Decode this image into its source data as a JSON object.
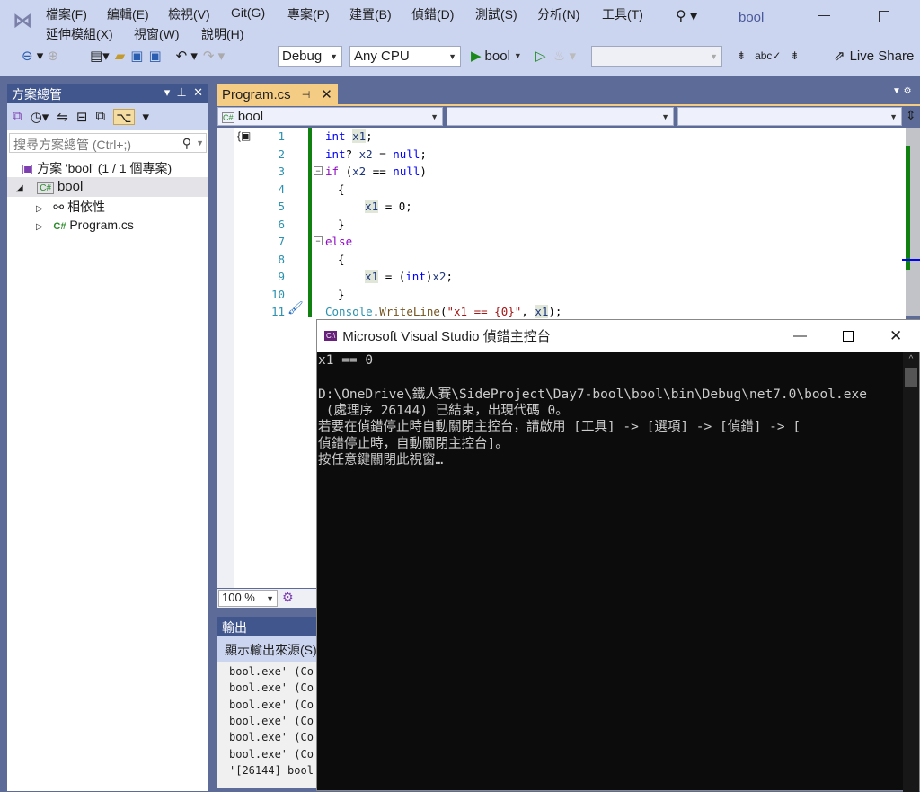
{
  "menu": [
    "檔案(F)",
    "編輯(E)",
    "檢視(V)",
    "Git(G)",
    "專案(P)",
    "建置(B)",
    "偵錯(D)",
    "測試(S)",
    "分析(N)",
    "工具(T)"
  ],
  "menu2": [
    "延伸模組(X)",
    "視窗(W)",
    "說明(H)"
  ],
  "window_title": "bool",
  "toolbar": {
    "config": "Debug",
    "platform": "Any CPU",
    "start": "bool",
    "live_share": "Live Share"
  },
  "solution_explorer": {
    "title": "方案總管",
    "search_placeholder": "搜尋方案總管 (Ctrl+;)",
    "solution": "方案 'bool' (1 / 1 個專案)",
    "project": "bool",
    "dependencies": "相依性",
    "file": "Program.cs"
  },
  "editor": {
    "tab": "Program.cs",
    "nav_scope": "bool",
    "zoom": "100 %",
    "lines": [
      [
        {
          "t": "int ",
          "c": "#0000ff"
        },
        {
          "t": "x1",
          "c": "#1f377f",
          "h": 1
        },
        {
          "t": ";",
          "c": "#000"
        }
      ],
      [
        {
          "t": "int",
          "c": "#0000ff"
        },
        {
          "t": "? ",
          "c": "#000"
        },
        {
          "t": "x2",
          "c": "#1f377f"
        },
        {
          "t": " = ",
          "c": "#000"
        },
        {
          "t": "null",
          "c": "#0000ff"
        },
        {
          "t": ";",
          "c": "#000"
        }
      ],
      [
        {
          "t": "if",
          "c": "#8f08c4"
        },
        {
          "t": " (",
          "c": "#000"
        },
        {
          "t": "x2",
          "c": "#1f377f"
        },
        {
          "t": " == ",
          "c": "#000"
        },
        {
          "t": "null",
          "c": "#0000ff"
        },
        {
          "t": ")",
          "c": "#000"
        }
      ],
      [
        {
          "t": "{",
          "c": "#000"
        }
      ],
      [
        {
          "t": "    ",
          "c": "#000"
        },
        {
          "t": "x1",
          "c": "#1f377f",
          "h": 1
        },
        {
          "t": " = 0;",
          "c": "#000"
        }
      ],
      [
        {
          "t": "}",
          "c": "#000"
        }
      ],
      [
        {
          "t": "else",
          "c": "#8f08c4"
        }
      ],
      [
        {
          "t": "{",
          "c": "#000"
        }
      ],
      [
        {
          "t": "    ",
          "c": "#000"
        },
        {
          "t": "x1",
          "c": "#1f377f",
          "h": 1
        },
        {
          "t": " = (",
          "c": "#000"
        },
        {
          "t": "int",
          "c": "#0000ff"
        },
        {
          "t": ")",
          "c": "#000"
        },
        {
          "t": "x2",
          "c": "#1f377f"
        },
        {
          "t": ";",
          "c": "#000"
        }
      ],
      [
        {
          "t": "}",
          "c": "#000"
        }
      ],
      [
        {
          "t": "Console",
          "c": "#2b91af"
        },
        {
          "t": ".",
          "c": "#000"
        },
        {
          "t": "WriteLine",
          "c": "#74531f"
        },
        {
          "t": "(",
          "c": "#000"
        },
        {
          "t": "\"x1 == {0}\"",
          "c": "#a31515"
        },
        {
          "t": ", ",
          "c": "#000"
        },
        {
          "t": "x1",
          "c": "#1f377f",
          "h": 1
        },
        {
          "t": ");",
          "c": "#000"
        }
      ]
    ]
  },
  "output": {
    "title": "輸出",
    "source_label": "顯示輸出來源(S)",
    "lines": [
      "bool.exe' (Co",
      "bool.exe' (Co",
      "bool.exe' (Co",
      "bool.exe' (Co",
      "bool.exe' (Co",
      "bool.exe' (Co",
      "'[26144] bool"
    ]
  },
  "console": {
    "title": "Microsoft Visual Studio 偵錯主控台",
    "lines": [
      "x1 == 0",
      "",
      "D:\\OneDrive\\鐵人賽\\SideProject\\Day7-bool\\bool\\bin\\Debug\\net7.0\\bool.exe",
      " (處理序 26144) 已結束，出現代碼 0。",
      "若要在偵錯停止時自動關閉主控台，請啟用 [工具] -> [選項] -> [偵錯] -> [",
      "偵錯停止時，自動關閉主控台]。",
      "按任意鍵關閉此視窗…"
    ]
  }
}
